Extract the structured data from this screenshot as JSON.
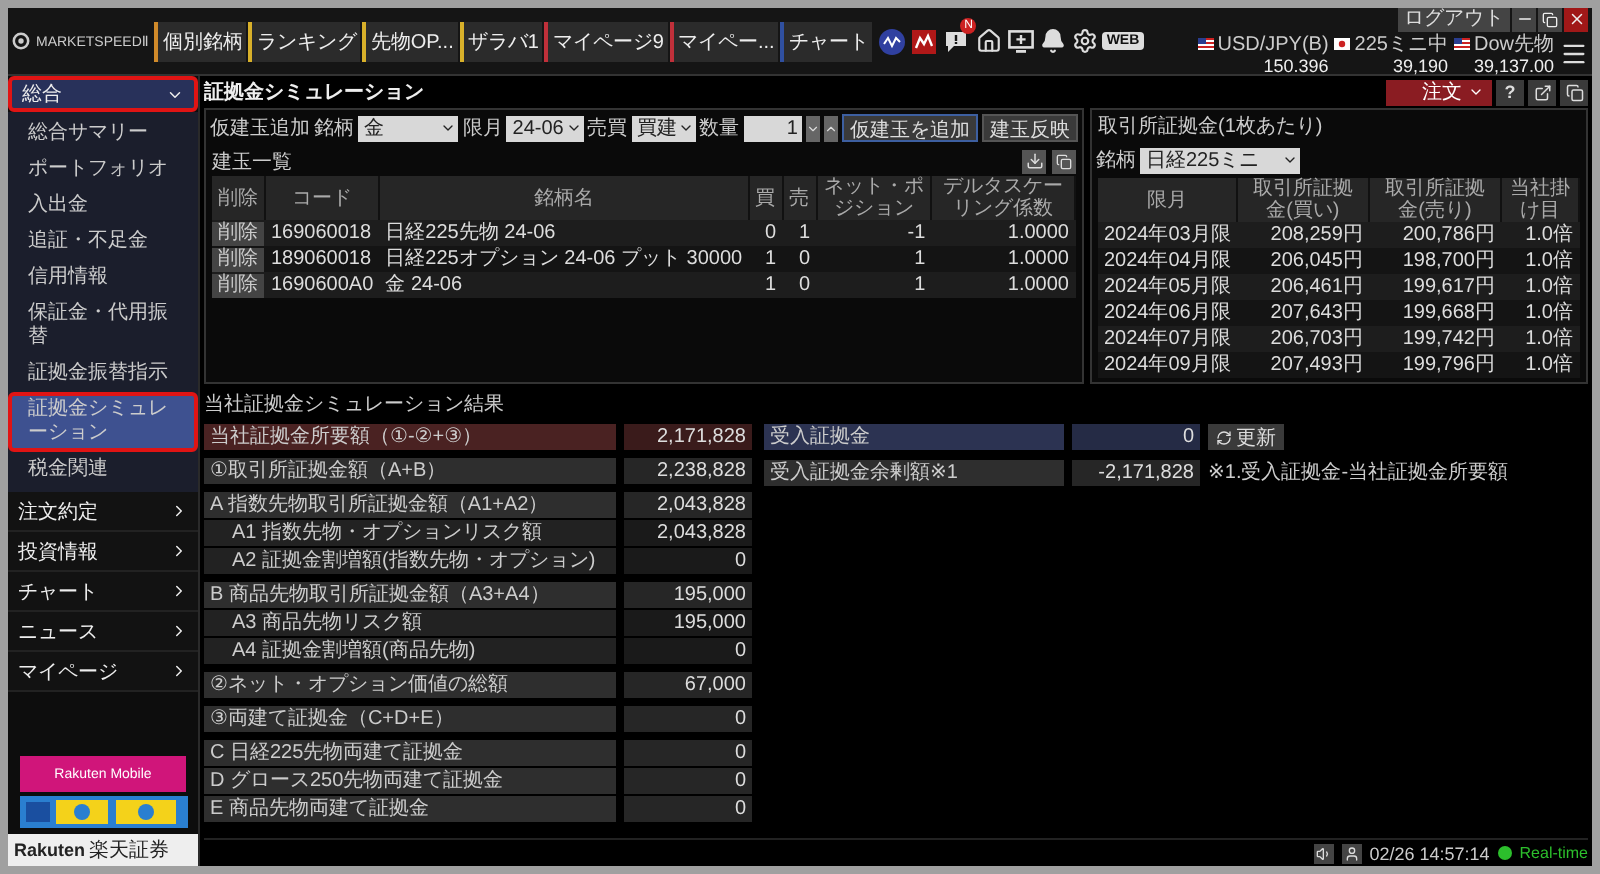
{
  "topbar": {
    "logo": "MARKETSPEEDⅡ",
    "tabs": [
      {
        "label": "個別銘柄",
        "color": "#d08a2a"
      },
      {
        "label": "ランキング",
        "color": "#d8b02a"
      },
      {
        "label": "先物OP...",
        "color": "#d8b02a"
      },
      {
        "label": "ザラバ1",
        "color": "#d8b02a"
      },
      {
        "label": "マイページ9",
        "color": "#c0303a"
      },
      {
        "label": "マイペー...",
        "color": "#c0303a"
      },
      {
        "label": "チャート",
        "color": "#3050a0"
      }
    ],
    "badge": "N",
    "web": "WEB",
    "tickers": [
      {
        "name": "USD/JPY(B)",
        "kind": "us",
        "value": "150.396"
      },
      {
        "name": "225ミニ中",
        "kind": "jp",
        "value": "39,190"
      },
      {
        "name": "Dow先物",
        "kind": "us",
        "value": "39,137.00"
      }
    ],
    "logout": "ログアウト"
  },
  "sidebar": {
    "groups": [
      {
        "label": "総合",
        "expanded": true,
        "highlighted": true,
        "children": [
          {
            "label": "総合サマリー",
            "selected": false,
            "highlighted": false
          },
          {
            "label": "ポートフォリオ",
            "selected": false,
            "highlighted": false
          },
          {
            "label": "入出金",
            "selected": false,
            "highlighted": false
          },
          {
            "label": "追証・不足金",
            "selected": false,
            "highlighted": false
          },
          {
            "label": "信用情報",
            "selected": false,
            "highlighted": false
          },
          {
            "label": "保証金・代用振替",
            "selected": false,
            "highlighted": false
          },
          {
            "label": "証拠金振替指示",
            "selected": false,
            "highlighted": false
          },
          {
            "label": "証拠金シミュレーション",
            "selected": true,
            "highlighted": true
          },
          {
            "label": "税金関連",
            "selected": false,
            "highlighted": false
          }
        ]
      },
      {
        "label": "注文約定",
        "expanded": false,
        "highlighted": false
      },
      {
        "label": "投資情報",
        "expanded": false,
        "highlighted": false
      },
      {
        "label": "チャート",
        "expanded": false,
        "highlighted": false
      },
      {
        "label": "ニュース",
        "expanded": false,
        "highlighted": false
      },
      {
        "label": "マイページ",
        "expanded": false,
        "highlighted": false
      }
    ],
    "banner": "Rakuten Mobile",
    "brand": "Rakuten",
    "brand_ja": "楽天証券"
  },
  "page": {
    "title": "証拠金シミュレーション",
    "order_button": "注文",
    "help_button": "?"
  },
  "form": {
    "label": "仮建玉追加",
    "fields": [
      {
        "label": "銘柄",
        "value": "金",
        "kind": "select"
      },
      {
        "label": "限月",
        "value": "24-06",
        "kind": "select"
      },
      {
        "label": "売買",
        "value": "買建",
        "kind": "select"
      },
      {
        "label": "数量",
        "value": "1",
        "kind": "spin"
      }
    ],
    "buttons": [
      "仮建玉を追加",
      "建玉反映"
    ]
  },
  "positions": {
    "title": "建玉一覧",
    "columns": [
      "削除",
      "コード",
      "銘柄名",
      "買",
      "売",
      "ネット・ポジション",
      "デルタスケーリング係数"
    ],
    "rows": [
      {
        "delete": "削除",
        "code": "169060018",
        "name": "日経225先物 24-06",
        "buy": "0",
        "sell": "1",
        "net": "-1",
        "delta": "1.0000"
      },
      {
        "delete": "削除",
        "code": "189060018",
        "name": "日経225オプション 24-06 プット 30000",
        "buy": "1",
        "sell": "0",
        "net": "1",
        "delta": "1.0000"
      },
      {
        "delete": "削除",
        "code": "1690600A0",
        "name": "金 24-06",
        "buy": "1",
        "sell": "0",
        "net": "1",
        "delta": "1.0000"
      }
    ]
  },
  "exchange_margin": {
    "title": "取引所証拠金(1枚あたり)",
    "symbol_label": "銘柄",
    "symbol": "日経225ミニ",
    "columns": [
      "限月",
      "取引所証拠金(買い)",
      "取引所証拠金(売り)",
      "当社掛け目"
    ],
    "rows": [
      {
        "month": "2024年03月限",
        "buy": "208,259円",
        "sell": "200,786円",
        "rate": "1.0倍"
      },
      {
        "month": "2024年04月限",
        "buy": "206,045円",
        "sell": "198,700円",
        "rate": "1.0倍"
      },
      {
        "month": "2024年05月限",
        "buy": "206,461円",
        "sell": "199,617円",
        "rate": "1.0倍"
      },
      {
        "month": "2024年06月限",
        "buy": "207,643円",
        "sell": "199,668円",
        "rate": "1.0倍"
      },
      {
        "month": "2024年07月限",
        "buy": "206,703円",
        "sell": "199,742円",
        "rate": "1.0倍"
      },
      {
        "month": "2024年09月限",
        "buy": "207,493円",
        "sell": "199,796円",
        "rate": "1.0倍"
      }
    ]
  },
  "results": {
    "title": "当社証拠金シミュレーション結果",
    "groups": [
      [
        {
          "label": "当社証拠金所要額（①-②+③）",
          "value": "2,171,828",
          "kind": "total"
        }
      ],
      [
        {
          "label": "①取引所証拠金額（A+B）",
          "value": "2,238,828",
          "kind": "plain"
        }
      ],
      [
        {
          "label": "A 指数先物取引所証拠金額（A1+A2）",
          "value": "2,043,828",
          "kind": "plain"
        },
        {
          "label": "A1 指数先物・オプションリスク額",
          "value": "2,043,828",
          "kind": "sub"
        },
        {
          "label": "A2 証拠金割増額(指数先物・オプション)",
          "value": "0",
          "kind": "sub"
        }
      ],
      [
        {
          "label": "B 商品先物取引所証拠金額（A3+A4）",
          "value": "195,000",
          "kind": "plain"
        },
        {
          "label": "A3 商品先物リスク額",
          "value": "195,000",
          "kind": "sub"
        },
        {
          "label": "A4 証拠金割増額(商品先物)",
          "value": "0",
          "kind": "sub"
        }
      ],
      [
        {
          "label": "②ネット・オプション価値の総額",
          "value": "67,000",
          "kind": "plain"
        }
      ],
      [
        {
          "label": "③両建て証拠金（C+D+E）",
          "value": "0",
          "kind": "plain"
        }
      ],
      [
        {
          "label": "C 日経225先物両建て証拠金",
          "value": "0",
          "kind": "plain"
        },
        {
          "label": "D グロース250先物両建て証拠金",
          "value": "0",
          "kind": "plain"
        },
        {
          "label": "E 商品先物両建て証拠金",
          "value": "0",
          "kind": "plain"
        }
      ]
    ],
    "deposit": [
      {
        "label": "受入証拠金",
        "value": "0",
        "kind": "deposit",
        "button": "更新"
      },
      {
        "label": "受入証拠金余剰額※1",
        "value": "-2,171,828",
        "kind": "plain",
        "note": "※1.受入証拠金-当社証拠金所要額"
      }
    ]
  },
  "status": {
    "time": "02/26 14:57:14",
    "feed": "Real-time"
  }
}
